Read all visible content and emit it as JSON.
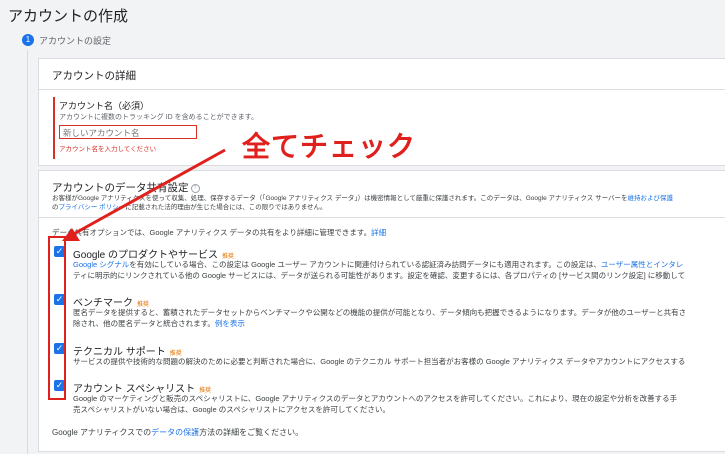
{
  "page": {
    "title": "アカウントの作成",
    "step_number": "1",
    "step_label": "アカウントの設定"
  },
  "details": {
    "title": "アカウントの詳細",
    "name_label": "アカウント名（必須）",
    "name_hint": "アカウントに複数のトラッキング ID を含めることができます。",
    "name_placeholder": "新しいアカウント名",
    "name_error": "アカウント名を入力してください"
  },
  "sharing": {
    "title": "アカウントのデータ共有設定",
    "desc_line1_a": "お客様がGoogle アナリティクスを使って収集、処理、保存するデータ（「Google アナリティクス データ」）は機密情報として厳重に保護されます。このデータは、Google アナリティクス サーバーを",
    "desc_line1_link": "維持および保護",
    "desc_line2_a": "の",
    "desc_line2_link": "プライバシー ポリシー",
    "desc_line2_b": "に記載された法的理由が生じた場合には、この限りではありません。",
    "intro_text": "データ共有オプションでは、Google アナリティクス データの共有をより詳細に管理できます。",
    "intro_link": "詳細",
    "footer_text_a": "Google アナリティクスでの",
    "footer_link": "データの保護",
    "footer_text_b": "方法の詳細をご覧ください。"
  },
  "options": [
    {
      "title": "Google のプロダクトやサービス",
      "badge": "推奨",
      "line1_link": "Google シグナル",
      "line1": "を有効にしている場合、この設定は Google ユーザー アカウントに関連付けられている認証済み訪問データにも適用されます。この設定は、",
      "line1_link2": "ユーザー属性とインタレ",
      "line2": "ティに明示的にリンクされている他の Google サービスには、データが送られる可能性があります。設定を確認、変更するには、各プロパティの [サービス間のリンク設定] に移動して"
    },
    {
      "title": "ベンチマーク",
      "badge": "推奨",
      "line1": "匿名データを提供すると、蓄積されたデータセットからベンチマークや公開などの機能の提供が可能となり、データ傾向も把握できるようになります。データが他のユーザーと共有さ",
      "line2": "除され、他の匿名データと統合されます。",
      "line2_link": "例を表示"
    },
    {
      "title": "テクニカル サポート",
      "badge": "推奨",
      "line1": "サービスの提供や技術的な問題の解決のために必要と判断された場合に、Google のテクニカル サポート担当者がお客様の Google アナリティクス データやアカウントにアクセスする"
    },
    {
      "title": "アカウント スペシャリスト",
      "badge": "推奨",
      "line1": "Google のマーケティングと販売のスペシャリストに、Google アナリティクスのデータとアカウントへのアクセスを許可してください。これにより、現在の設定や分析を改善する手",
      "line2": "売スペシャリストがいない場合は、Google のスペシャリストにアクセスを許可してください。"
    }
  ],
  "annotation": {
    "text": "全てチェック"
  },
  "colors": {
    "accent": "#1a73e8",
    "annotation_red": "#e0201c",
    "error_red": "#d93025",
    "badge_orange": "#e37400"
  }
}
